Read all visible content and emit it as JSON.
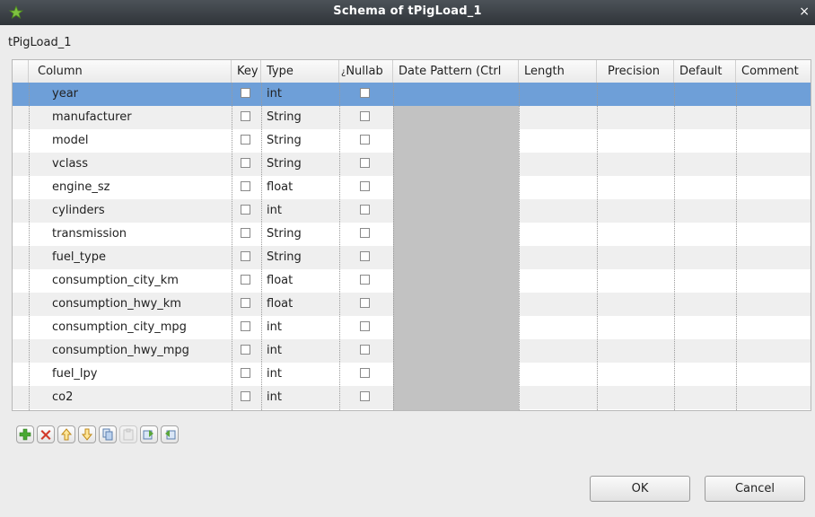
{
  "window": {
    "title": "Schema of tPigLoad_1",
    "close_glyph": "×"
  },
  "component_name": "tPigLoad_1",
  "table": {
    "headers": {
      "column": "Column",
      "key": "Key",
      "type": "Type",
      "nullable": "Nullab",
      "nullable_prefix": "¿",
      "date_pattern": "Date Pattern (Ctrl",
      "length": "Length",
      "precision": "Precision",
      "default": "Default",
      "comment": "Comment"
    },
    "rows": [
      {
        "name": "year",
        "type": "int",
        "key": false,
        "nullable": false
      },
      {
        "name": "manufacturer",
        "type": "String",
        "key": false,
        "nullable": false
      },
      {
        "name": "model",
        "type": "String",
        "key": false,
        "nullable": false
      },
      {
        "name": "vclass",
        "type": "String",
        "key": false,
        "nullable": false
      },
      {
        "name": "engine_sz",
        "type": "float",
        "key": false,
        "nullable": false
      },
      {
        "name": "cylinders",
        "type": "int",
        "key": false,
        "nullable": false
      },
      {
        "name": "transmission",
        "type": "String",
        "key": false,
        "nullable": false
      },
      {
        "name": "fuel_type",
        "type": "String",
        "key": false,
        "nullable": false
      },
      {
        "name": "consumption_city_km",
        "type": "float",
        "key": false,
        "nullable": false
      },
      {
        "name": "consumption_hwy_km",
        "type": "float",
        "key": false,
        "nullable": false
      },
      {
        "name": "consumption_city_mpg",
        "type": "int",
        "key": false,
        "nullable": false
      },
      {
        "name": "consumption_hwy_mpg",
        "type": "int",
        "key": false,
        "nullable": false
      },
      {
        "name": "fuel_lpy",
        "type": "int",
        "key": false,
        "nullable": false
      },
      {
        "name": "co2",
        "type": "int",
        "key": false,
        "nullable": false
      }
    ],
    "selected_row": 0
  },
  "toolbar": {
    "buttons": [
      {
        "icon": "add-icon",
        "enabled": true
      },
      {
        "icon": "remove-icon",
        "enabled": true
      },
      {
        "icon": "move-up-icon",
        "enabled": true
      },
      {
        "icon": "move-down-icon",
        "enabled": true
      },
      {
        "icon": "copy-icon",
        "enabled": true
      },
      {
        "icon": "paste-icon",
        "enabled": false
      },
      {
        "icon": "import-schema-icon",
        "enabled": true
      },
      {
        "icon": "export-schema-icon",
        "enabled": true
      }
    ]
  },
  "buttons": {
    "ok": "OK",
    "cancel": "Cancel"
  },
  "colors": {
    "selection": "#6e9fd8",
    "titlebar": "#3a3f44",
    "date_pattern_disabled": "#c2c2c2"
  }
}
